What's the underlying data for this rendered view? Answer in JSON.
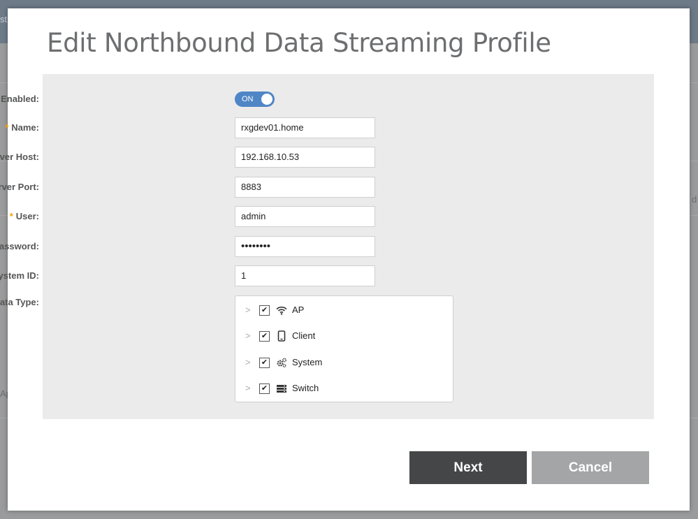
{
  "background": {
    "left_fragment": "Ap",
    "top_fragment": "st",
    "right_fragment": "d"
  },
  "dialog": {
    "title": "Edit Northbound Data Streaming Profile",
    "fields": {
      "enabled": {
        "label": "Enabled:",
        "value": "ON",
        "state": true
      },
      "name": {
        "label": "Name:",
        "required": "*",
        "value": "rxgdev01.home"
      },
      "server_host": {
        "label": "Server Host:",
        "required": "*",
        "value": "192.168.10.53"
      },
      "server_port": {
        "label": "Server Port:",
        "required": "*",
        "value": "8883"
      },
      "user": {
        "label": "User:",
        "required": "*",
        "value": "admin"
      },
      "password": {
        "label": "Password:",
        "required": "*",
        "value": "••••••••"
      },
      "system_id": {
        "label": "System ID:",
        "required": "*",
        "value": "1"
      }
    },
    "data_type": {
      "label": "Data Type:",
      "items": [
        {
          "label": "AP",
          "checked": true,
          "icon": "wifi-icon"
        },
        {
          "label": "Client",
          "checked": true,
          "icon": "mobile-icon"
        },
        {
          "label": "System",
          "checked": true,
          "icon": "gears-icon"
        },
        {
          "label": "Switch",
          "checked": true,
          "icon": "switch-icon"
        }
      ]
    },
    "buttons": {
      "next": "Next",
      "cancel": "Cancel"
    }
  },
  "colors": {
    "toggle_on": "#4f86c6",
    "required_marker": "#f5a100",
    "primary_button": "#444647",
    "secondary_button": "#a4a5a6"
  }
}
